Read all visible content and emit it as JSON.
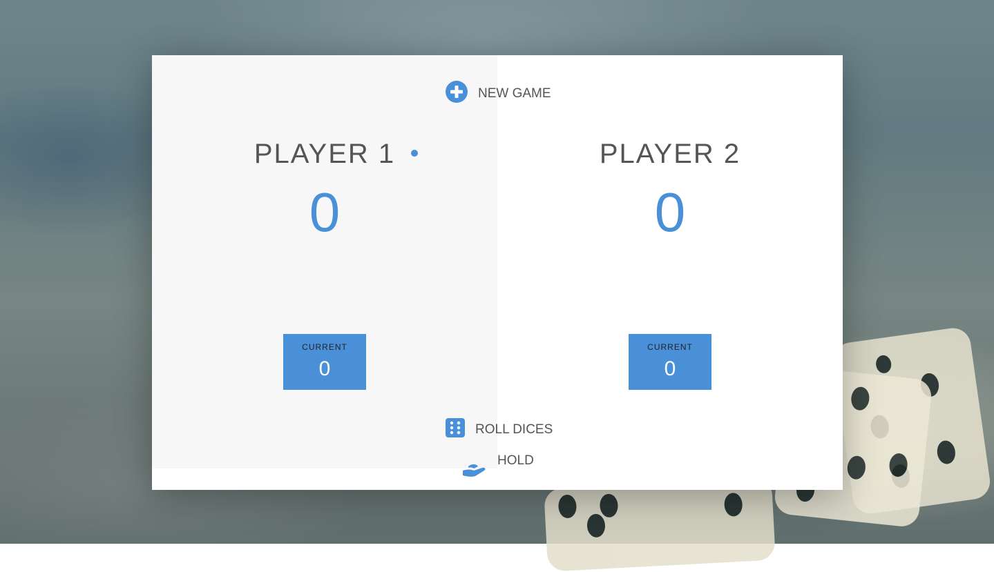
{
  "game": {
    "new_game_label": "NEW GAME",
    "roll_label": "ROLL DICES",
    "hold_label": "HOLD"
  },
  "players": [
    {
      "name": "PLAYER 1",
      "score": "0",
      "current_label": "CURRENT",
      "current_score": "0",
      "active": true
    },
    {
      "name": "PLAYER 2",
      "score": "0",
      "current_label": "CURRENT",
      "current_score": "0",
      "active": false
    }
  ],
  "colors": {
    "accent": "#4a90d9",
    "text": "#555555",
    "active_panel": "#f7f7f7",
    "panel": "#ffffff"
  },
  "icons": {
    "new_game": "plus-circle-icon",
    "roll": "dice-icon",
    "hold": "hand-icon",
    "active": "active-dot-icon"
  }
}
